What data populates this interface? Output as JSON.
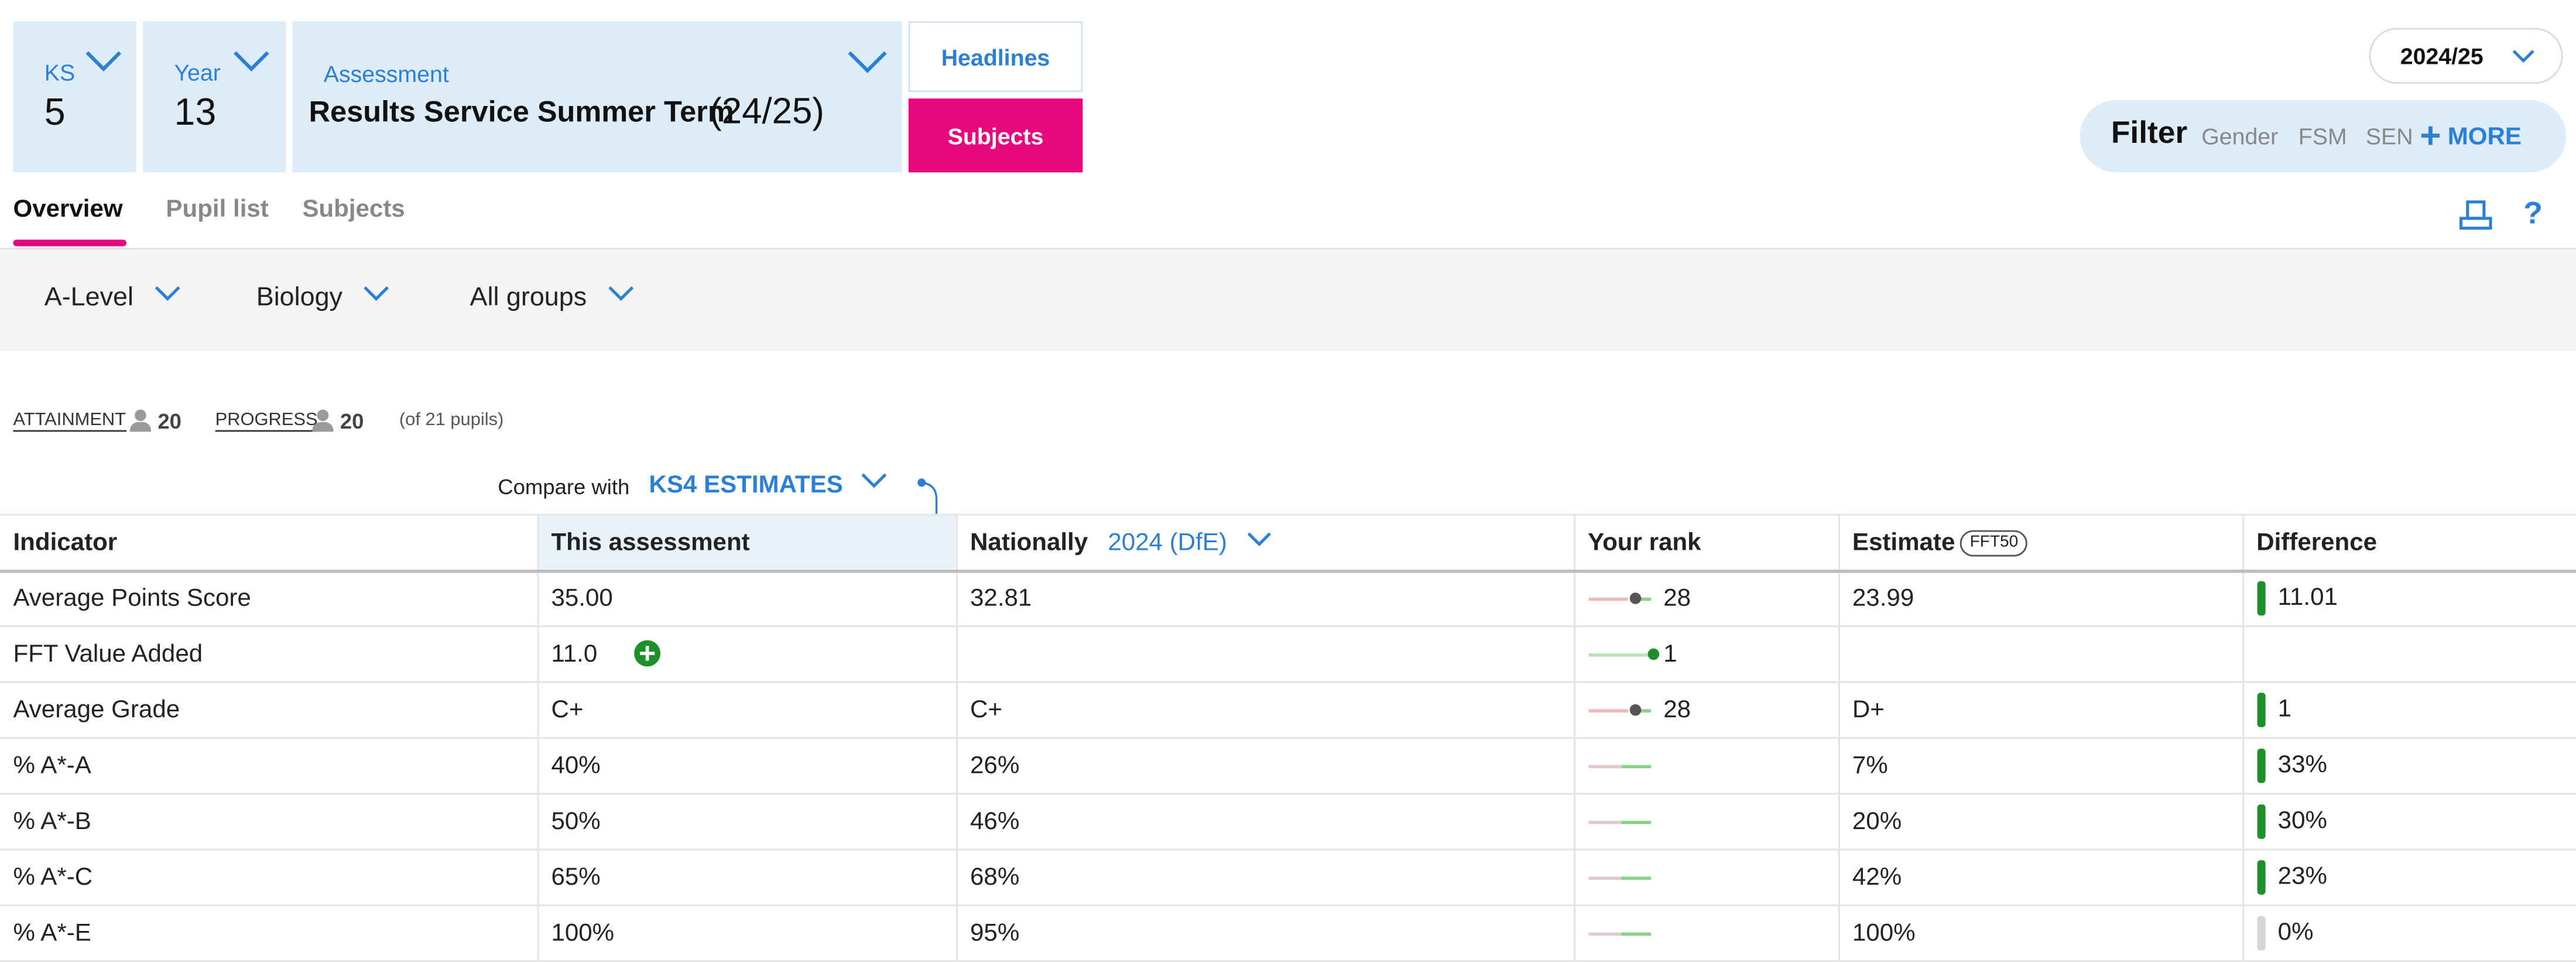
{
  "selectors": {
    "ks": {
      "label": "KS",
      "value": "5"
    },
    "year": {
      "label": "Year",
      "value": "13"
    },
    "assessment": {
      "label": "Assessment",
      "value": "Results Service Summer Term",
      "suffix": "(24/25)"
    }
  },
  "view_buttons": {
    "headlines": "Headlines",
    "subjects": "Subjects"
  },
  "year_select": "2024/25",
  "filter": {
    "label": "Filter",
    "options": [
      "Gender",
      "FSM",
      "SEN"
    ],
    "more": "MORE"
  },
  "tabs": [
    "Overview",
    "Pupil list",
    "Subjects"
  ],
  "active_tab": "Overview",
  "dropdowns": {
    "qualification": "A-Level",
    "subject": "Biology",
    "group": "All groups"
  },
  "counts": {
    "attainment_label": "ATTAINMENT",
    "attainment_count": "20",
    "progress_label": "PROGRESS",
    "progress_count": "20",
    "total": "(of 21 pupils)"
  },
  "compare": {
    "label": "Compare with",
    "value": "KS4 ESTIMATES"
  },
  "table": {
    "headers": {
      "indicator": "Indicator",
      "this_assessment": "This assessment",
      "nationally": "Nationally",
      "nationally_year": "2024 (DfE)",
      "rank": "Your rank",
      "estimate": "Estimate",
      "estimate_badge": "FFT50",
      "difference": "Difference"
    },
    "rows": [
      {
        "indicator": "Average Points Score",
        "this": "35.00",
        "national": "32.81",
        "rank": "28",
        "estimate": "23.99",
        "difference": "11.01",
        "diff_bar": "green"
      },
      {
        "indicator": "FFT Value Added",
        "this": "11.0",
        "national": "",
        "rank": "1",
        "estimate": "",
        "difference": "",
        "diff_bar": "none"
      },
      {
        "indicator": "Average Grade",
        "this": "C+",
        "national": "C+",
        "rank": "28",
        "estimate": "D+",
        "difference": "1",
        "diff_bar": "green"
      },
      {
        "indicator": "% A*-A",
        "this": "40%",
        "national": "26%",
        "rank": "",
        "estimate": "7%",
        "difference": "33%",
        "diff_bar": "green"
      },
      {
        "indicator": "% A*-B",
        "this": "50%",
        "national": "46%",
        "rank": "",
        "estimate": "20%",
        "difference": "30%",
        "diff_bar": "green"
      },
      {
        "indicator": "% A*-C",
        "this": "65%",
        "national": "68%",
        "rank": "",
        "estimate": "42%",
        "difference": "23%",
        "diff_bar": "green"
      },
      {
        "indicator": "% A*-E",
        "this": "100%",
        "national": "95%",
        "rank": "",
        "estimate": "100%",
        "difference": "0%",
        "diff_bar": "grey"
      }
    ]
  },
  "colors": {
    "accent_blue": "#2b7fd4",
    "brand_pink": "#e6077c",
    "positive_green": "#1e8f2a",
    "selector_bg": "#dcecf9"
  }
}
